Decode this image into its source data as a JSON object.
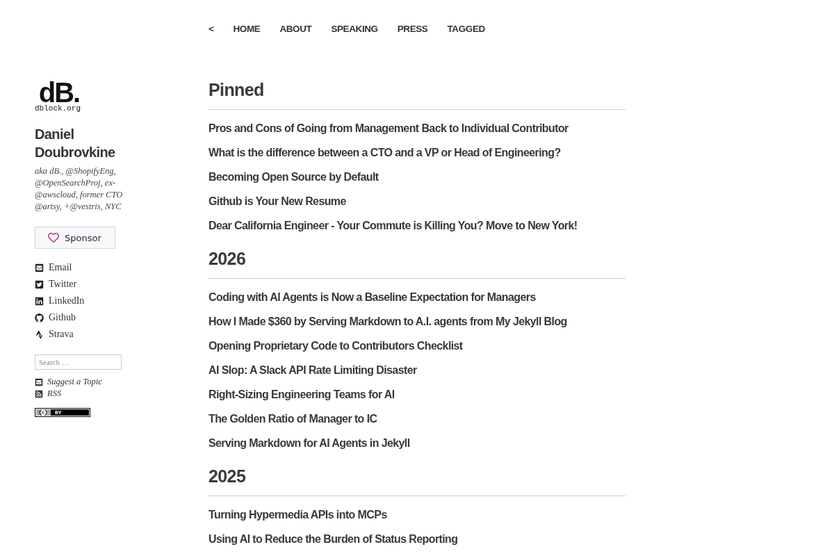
{
  "nav": {
    "back": "<",
    "items": [
      {
        "label": "HOME"
      },
      {
        "label": "ABOUT"
      },
      {
        "label": "SPEAKING"
      },
      {
        "label": "PRESS"
      },
      {
        "label": "TAGGED"
      }
    ]
  },
  "sidebar": {
    "logo": {
      "mark": "dB.",
      "caption": "dblock.org"
    },
    "name": "Daniel Doubrovkine",
    "tagline": "aka dB., @ShopifyEng, @OpenSearchProj, ex-@awscloud, former CTO @artsy, +@vestris, NYC",
    "sponsor_button": "Sponsor",
    "social_links": [
      {
        "kind": "email",
        "label": "Email"
      },
      {
        "kind": "twitter",
        "label": "Twitter"
      },
      {
        "kind": "linkedin",
        "label": "LinkedIn"
      },
      {
        "kind": "github",
        "label": "Github"
      },
      {
        "kind": "strava",
        "label": "Strava"
      }
    ],
    "search": {
      "placeholder": "Search …"
    },
    "extra_links": [
      {
        "kind": "email",
        "label": "Suggest a Topic"
      },
      {
        "kind": "rss",
        "label": "RSS"
      }
    ],
    "license_badge": {
      "label": "BY"
    }
  },
  "sections": [
    {
      "heading": "Pinned",
      "posts": [
        "Pros and Cons of Going from Management Back to Individual Contributor",
        "What is the difference between a CTO and a VP or Head of Engineering?",
        "Becoming Open Source by Default",
        "Github is Your New Resume",
        "Dear California Engineer - Your Commute is Killing You? Move to New York!"
      ]
    },
    {
      "heading": "2026",
      "posts": [
        "Coding with AI Agents is Now a Baseline Expectation for Managers",
        "How I Made $360 by Serving Markdown to A.I. agents from My Jekyll Blog",
        "Opening Proprietary Code to Contributors Checklist",
        "AI Slop: A Slack API Rate Limiting Disaster",
        "Right-Sizing Engineering Teams for AI",
        "The Golden Ratio of Manager to IC",
        "Serving Markdown for AI Agents in Jekyll"
      ]
    },
    {
      "heading": "2025",
      "posts": [
        "Turning Hypermedia APIs into MCPs",
        "Using AI to Reduce the Burden of Status Reporting"
      ]
    }
  ]
}
